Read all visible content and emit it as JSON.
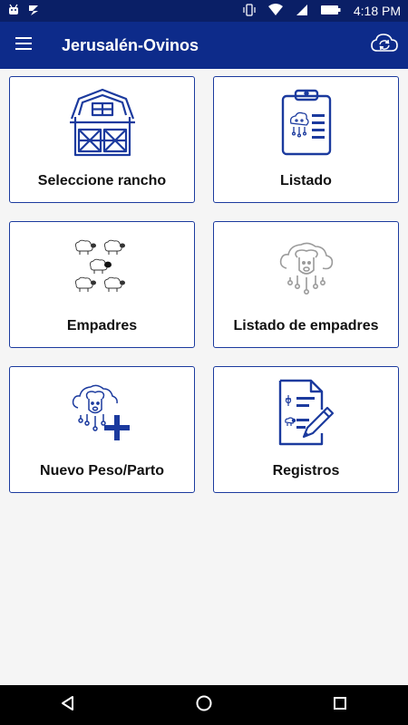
{
  "status_bar": {
    "time": "4:18 PM",
    "icons": [
      "android-icon",
      "bolt-icon",
      "vibrate-icon",
      "wifi-icon",
      "signal-icon",
      "battery-icon"
    ]
  },
  "app_bar": {
    "title": "Jerusalén-Ovinos",
    "menu_icon": "hamburger-menu-icon",
    "sync_icon": "cloud-sync-icon"
  },
  "cards": [
    {
      "label": "Seleccione rancho",
      "icon": "barn-icon"
    },
    {
      "label": "Listado",
      "icon": "clipboard-list-icon"
    },
    {
      "label": "Empadres",
      "icon": "sheep-flock-icon"
    },
    {
      "label": "Listado de empadres",
      "icon": "sheep-network-icon"
    },
    {
      "label": "Nuevo Peso/Parto",
      "icon": "sheep-add-icon"
    },
    {
      "label": "Registros",
      "icon": "document-edit-icon"
    }
  ],
  "nav_bar": {
    "back_icon": "back-triangle-icon",
    "home_icon": "home-circle-icon",
    "recents_icon": "recents-square-icon"
  },
  "colors": {
    "primary": "#0d2b8a",
    "status_bar": "#0a1f66",
    "card_border": "#1b3a9e",
    "icon_blue": "#1b3a9e",
    "icon_gray": "#9a9a9a",
    "background": "#f5f5f5"
  }
}
